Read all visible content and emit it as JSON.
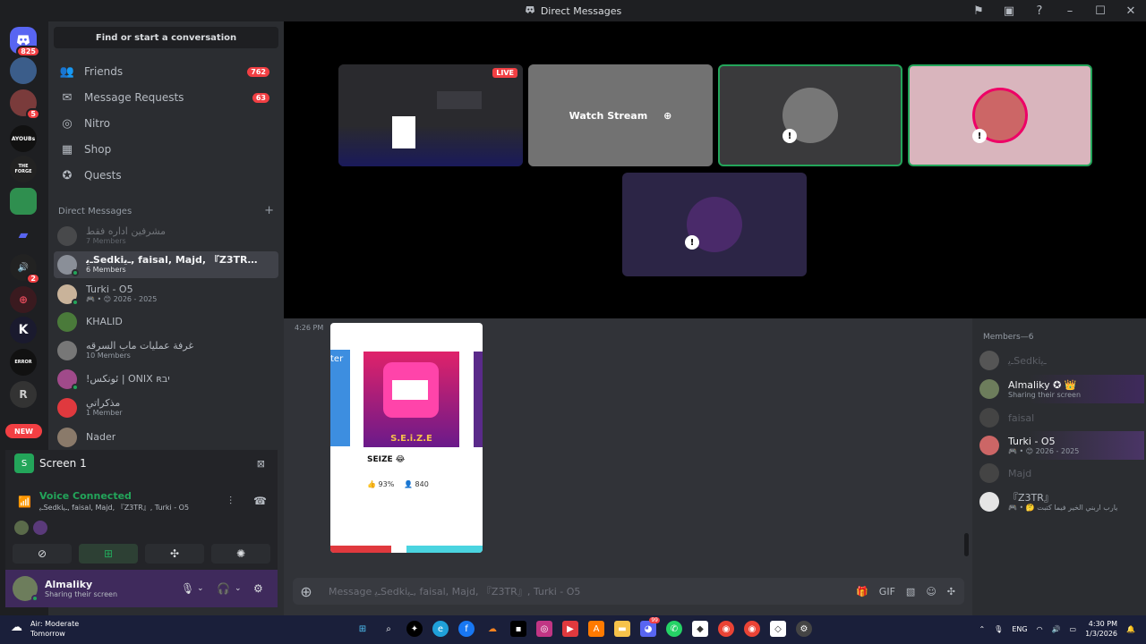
{
  "window": {
    "title": "Direct Messages"
  },
  "rail": {
    "discord_badge": "825",
    "server2_badge": "5",
    "server_label_ayoubs": "AYOUBs",
    "server_label_forge": "THE FORGE",
    "server_badge_speaker": "2",
    "new_label": "NEW"
  },
  "sidebar": {
    "search_label": "Find or start a conversation",
    "nav": [
      {
        "label": "Friends",
        "icon": "friends-icon",
        "count": "762"
      },
      {
        "label": "Message Requests",
        "icon": "mail-icon",
        "count": "63"
      },
      {
        "label": "Nitro",
        "icon": "nitro-icon"
      },
      {
        "label": "Shop",
        "icon": "shop-icon"
      },
      {
        "label": "Quests",
        "icon": "quests-icon"
      }
    ],
    "dm_header": "Direct Messages",
    "dms": [
      {
        "name": "مشرفين اداره فقط",
        "sub": "7 Members"
      },
      {
        "name": "ـﯾSedkiـﯾ, faisal, Majd, 『Z3TR』, T...",
        "sub": "6 Members"
      },
      {
        "name": "Turki - O5",
        "sub": "🎮 • 😊 2026 - 2025"
      },
      {
        "name": "KHALID",
        "sub": ""
      },
      {
        "name": "غرفة عمليات ماب السرقه",
        "sub": "10 Members"
      },
      {
        "name": "!ئونكس | ONIX ʀיב",
        "sub": ""
      },
      {
        "name": "مذكراتي",
        "sub": "1 Member"
      },
      {
        "name": "Nader",
        "sub": ""
      }
    ]
  },
  "stream_panel": {
    "label": "Screen 1"
  },
  "voice": {
    "status": "Voice Connected",
    "channel": "ـﯾSedkiـﯾ, faisal, Majd, 『Z3TR』, Turki - O5"
  },
  "user": {
    "name": "Almaliky",
    "status": "Sharing their screen"
  },
  "stage": {
    "live_label": "LIVE",
    "watch_label": "Watch Stream"
  },
  "chat": {
    "time": "4:26 PM",
    "card": {
      "game_title": "S.E.i.Z.E",
      "name": "SEIZE 😂",
      "rating": "93%",
      "players": "840",
      "partial_left": "ter"
    },
    "composer_placeholder": "Message ـﯾSedkiـﯾ, faisal, Majd, 『Z3TR』, Turki - O5"
  },
  "members": {
    "header": "Members—6",
    "list": [
      {
        "name": "ـﯾSedkiـﯾ",
        "sub": "",
        "dim": true
      },
      {
        "name": "Almaliky ✪ 👑",
        "sub": "Sharing their screen",
        "dim": false
      },
      {
        "name": "faisal",
        "sub": "",
        "dim": true
      },
      {
        "name": "Turki - O5",
        "sub": "🎮 • 😊 2026 - 2025",
        "dim": false
      },
      {
        "name": "Majd",
        "sub": "",
        "dim": true
      },
      {
        "name": "『Z3TR』",
        "sub": "🎮 • 🤔 يارب اربني الخير فيما كتبت",
        "dim": false
      }
    ]
  },
  "taskbar": {
    "weather_title": "Air: Moderate",
    "weather_sub": "Tomorrow",
    "lang": "ENG",
    "time": "4:30 PM",
    "date": "1/3/2026",
    "badge_discord": "99"
  },
  "colors": {
    "accent_green": "#23a55a",
    "accent_red": "#f23f43",
    "discord_blurple": "#5865f2",
    "user_panel_purple": "#3f2a5c"
  }
}
